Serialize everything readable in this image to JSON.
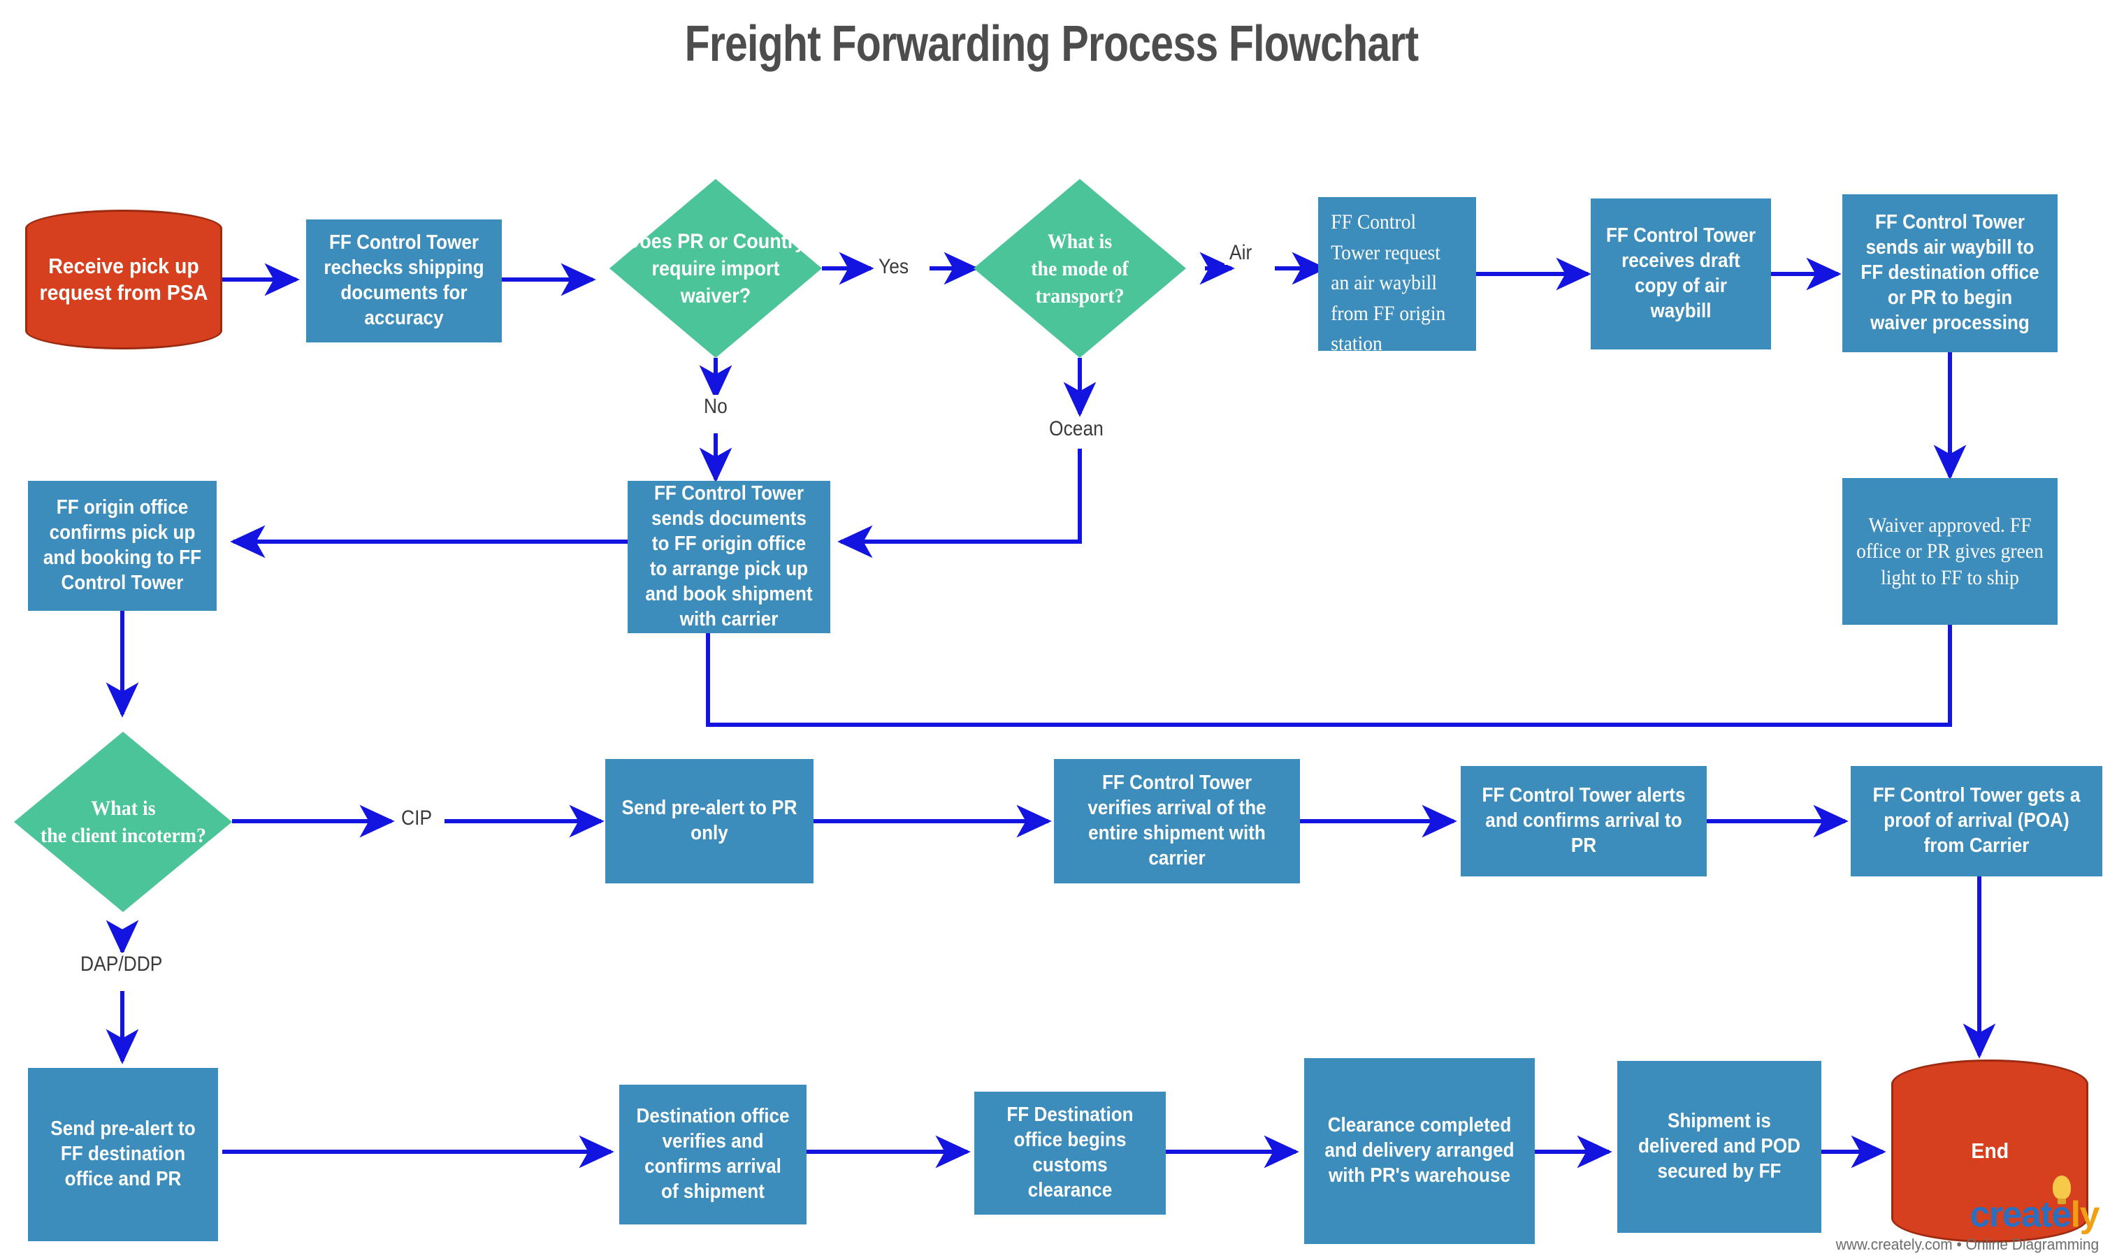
{
  "title": "Freight Forwarding Process Flowchart",
  "colors": {
    "process_fill": "#3d8dbc",
    "decision_fill": "#4cc49a",
    "terminator_fill": "#d6401e",
    "terminator_stroke": "#9c2b12",
    "connector": "#1414e0",
    "title_text": "#4d4d4d",
    "label_text": "#3a3a3a",
    "node_text": "#ffffff"
  },
  "nodes": {
    "start": "Receive pick up request from PSA",
    "recheck_docs": "FF Control Tower rechecks shipping documents for accuracy",
    "waiver_decision": "Does PR or Country require import waiver?",
    "mode_decision": "What is\nthe mode  of\ntransport?",
    "request_awb": "FF Control Tower request an air   waybill from FF origin station",
    "receive_draft_awb": "FF Control Tower receives draft copy of air waybill",
    "send_awb": "FF Control Tower sends air waybill to FF destination office or PR to begin waiver processing",
    "waiver_approved": "Waiver approved. FF office or PR gives green light to FF to ship",
    "origin_confirms": "FF origin office confirms pick up and booking to FF Control Tower",
    "send_documents": "FF Control Tower sends documents to FF origin office to arrange pick up and book shipment with carrier",
    "incoterm_decision": "What is\nthe client  incoterm?",
    "prealert_pr": "Send pre-alert to PR only",
    "verify_arrival": "FF Control Tower verifies arrival of the entire shipment with carrier",
    "alerts_pr": "FF Control Tower alerts and confirms arrival to PR",
    "poa_carrier": "FF Control Tower gets a proof of arrival (POA) from Carrier",
    "prealert_dest": "Send pre-alert to FF destination office and PR",
    "dest_verifies": "Destination office verifies and confirms arrival of shipment",
    "customs_clearance": "FF Destination office begins customs clearance",
    "clearance_completed": "Clearance completed and delivery arranged with PR's warehouse",
    "delivered_pod": "Shipment is delivered and POD secured by FF",
    "end": "End"
  },
  "edge_labels": {
    "yes": "Yes",
    "no": "No",
    "air": "Air",
    "ocean": "Ocean",
    "cip": "CIP",
    "dap_ddp": "DAP/DDP"
  },
  "watermark": {
    "brand_part1": "create",
    "brand_part2": "ly",
    "tagline": "www.creately.com • Online Diagramming"
  },
  "chart_data": {
    "type": "flowchart",
    "title": "Freight Forwarding Process Flowchart",
    "shapes": [
      {
        "id": "start",
        "type": "terminator",
        "label": "Receive pick up request from PSA"
      },
      {
        "id": "recheck_docs",
        "type": "process",
        "label": "FF Control Tower rechecks shipping documents for accuracy"
      },
      {
        "id": "waiver_decision",
        "type": "decision",
        "label": "Does PR or Country require import waiver?"
      },
      {
        "id": "mode_decision",
        "type": "decision",
        "label": "What is the mode of transport?"
      },
      {
        "id": "request_awb",
        "type": "process",
        "label": "FF Control Tower request an air waybill from FF origin station"
      },
      {
        "id": "receive_draft_awb",
        "type": "process",
        "label": "FF Control Tower receives draft copy of air waybill"
      },
      {
        "id": "send_awb",
        "type": "process",
        "label": "FF Control Tower sends air waybill to FF destination office or PR to begin waiver processing"
      },
      {
        "id": "waiver_approved",
        "type": "process",
        "label": "Waiver approved. FF office or PR gives green light to FF to ship"
      },
      {
        "id": "send_documents",
        "type": "process",
        "label": "FF Control Tower sends documents to FF origin office to arrange pick up and book shipment with carrier"
      },
      {
        "id": "origin_confirms",
        "type": "process",
        "label": "FF origin office confirms pick up and booking to FF Control Tower"
      },
      {
        "id": "incoterm_decision",
        "type": "decision",
        "label": "What is the client incoterm?"
      },
      {
        "id": "prealert_pr",
        "type": "process",
        "label": "Send pre-alert to PR only"
      },
      {
        "id": "verify_arrival",
        "type": "process",
        "label": "FF Control Tower verifies arrival of the entire shipment with carrier"
      },
      {
        "id": "alerts_pr",
        "type": "process",
        "label": "FF Control Tower alerts and confirms arrival to PR"
      },
      {
        "id": "poa_carrier",
        "type": "process",
        "label": "FF Control Tower gets a proof of arrival (POA) from Carrier"
      },
      {
        "id": "prealert_dest",
        "type": "process",
        "label": "Send pre-alert to FF destination office and PR"
      },
      {
        "id": "dest_verifies",
        "type": "process",
        "label": "Destination office verifies and confirms arrival of shipment"
      },
      {
        "id": "customs_clearance",
        "type": "process",
        "label": "FF Destination office begins customs clearance"
      },
      {
        "id": "clearance_completed",
        "type": "process",
        "label": "Clearance completed and delivery arranged with PR's warehouse"
      },
      {
        "id": "delivered_pod",
        "type": "process",
        "label": "Shipment is delivered and POD secured by FF"
      },
      {
        "id": "end",
        "type": "terminator",
        "label": "End"
      }
    ],
    "edges": [
      {
        "from": "start",
        "to": "recheck_docs",
        "label": ""
      },
      {
        "from": "recheck_docs",
        "to": "waiver_decision",
        "label": ""
      },
      {
        "from": "waiver_decision",
        "to": "mode_decision",
        "label": "Yes"
      },
      {
        "from": "waiver_decision",
        "to": "send_documents",
        "label": "No"
      },
      {
        "from": "mode_decision",
        "to": "request_awb",
        "label": "Air"
      },
      {
        "from": "mode_decision",
        "to": "send_documents",
        "label": "Ocean"
      },
      {
        "from": "request_awb",
        "to": "receive_draft_awb",
        "label": ""
      },
      {
        "from": "receive_draft_awb",
        "to": "send_awb",
        "label": ""
      },
      {
        "from": "send_awb",
        "to": "waiver_approved",
        "label": ""
      },
      {
        "from": "waiver_approved",
        "to": "send_documents",
        "label": ""
      },
      {
        "from": "send_documents",
        "to": "origin_confirms",
        "label": ""
      },
      {
        "from": "origin_confirms",
        "to": "incoterm_decision",
        "label": ""
      },
      {
        "from": "incoterm_decision",
        "to": "prealert_pr",
        "label": "CIP"
      },
      {
        "from": "incoterm_decision",
        "to": "prealert_dest",
        "label": "DAP/DDP"
      },
      {
        "from": "prealert_pr",
        "to": "verify_arrival",
        "label": ""
      },
      {
        "from": "verify_arrival",
        "to": "alerts_pr",
        "label": ""
      },
      {
        "from": "alerts_pr",
        "to": "poa_carrier",
        "label": ""
      },
      {
        "from": "poa_carrier",
        "to": "end",
        "label": ""
      },
      {
        "from": "prealert_dest",
        "to": "dest_verifies",
        "label": ""
      },
      {
        "from": "dest_verifies",
        "to": "customs_clearance",
        "label": ""
      },
      {
        "from": "customs_clearance",
        "to": "clearance_completed",
        "label": ""
      },
      {
        "from": "clearance_completed",
        "to": "delivered_pod",
        "label": ""
      },
      {
        "from": "delivered_pod",
        "to": "end",
        "label": ""
      }
    ]
  }
}
